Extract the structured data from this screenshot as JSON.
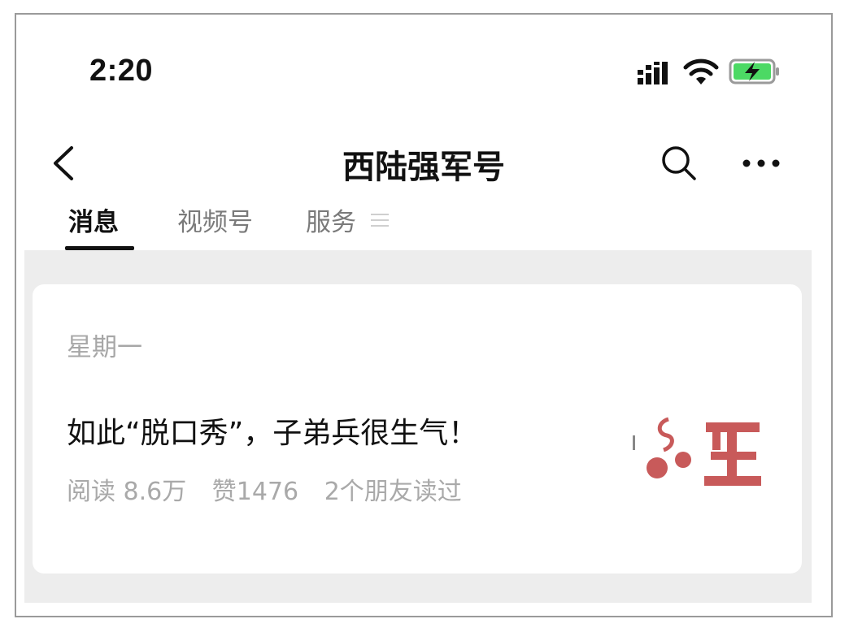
{
  "status_bar": {
    "time": "2:20"
  },
  "nav": {
    "title": "西陆强军号",
    "back_icon": "chevron-left-icon",
    "search_icon": "search-icon",
    "more_icon": "more-dots-icon"
  },
  "tabs": [
    {
      "label": "消息",
      "active": true
    },
    {
      "label": "视频号",
      "active": false
    },
    {
      "label": "服务",
      "active": false,
      "icon": "menu-lines-icon"
    }
  ],
  "feed": {
    "date": "星期一",
    "article": {
      "title": "如此“脱口秀”，子弟兵很生气！",
      "reads": "阅读 8.6万",
      "likes": "赞1476",
      "friends": "2个朋友读过"
    }
  },
  "colors": {
    "thumb_accent": "#c85a5a",
    "battery_green": "#4cd964",
    "tab_active": "#111111",
    "tab_inactive": "#7a7a7a"
  }
}
